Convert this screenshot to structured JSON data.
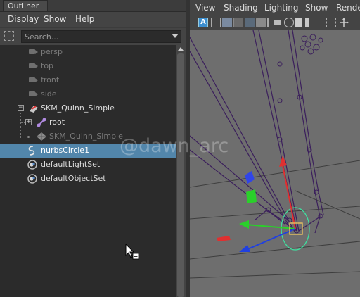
{
  "outliner": {
    "tab_label": "Outliner",
    "menus": [
      "Display",
      "Show",
      "Help"
    ],
    "search": {
      "placeholder": "Search..."
    },
    "items": [
      {
        "label": "persp",
        "icon": "camera-icon",
        "dim": true
      },
      {
        "label": "top",
        "icon": "camera-icon",
        "dim": true
      },
      {
        "label": "front",
        "icon": "camera-icon",
        "dim": true
      },
      {
        "label": "side",
        "icon": "camera-icon",
        "dim": true
      },
      {
        "label": "SKM_Quinn_Simple",
        "icon": "transform-group-icon",
        "dim": false
      },
      {
        "label": "root",
        "icon": "joint-icon",
        "dim": false
      },
      {
        "label": "SKM_Quinn_Simple",
        "icon": "mesh-icon",
        "dim": true
      },
      {
        "label": "nurbsCircle1",
        "icon": "nurbs-curve-icon",
        "selected": true
      },
      {
        "label": "defaultLightSet",
        "icon": "set-icon",
        "dim": false
      },
      {
        "label": "defaultObjectSet",
        "icon": "set-icon",
        "dim": false
      }
    ]
  },
  "viewport": {
    "menus": [
      "View",
      "Shading",
      "Lighting",
      "Show",
      "Rende"
    ],
    "toolbar_icons": [
      "select-camera-icon",
      "camera-attributes-icon",
      "bookmark-icon",
      "image-plane-icon",
      "grid-icon",
      "wireframe-icon",
      "smooth-shade-icon",
      "textured-icon",
      "lights-icon",
      "shadows-icon",
      "isolate-icon",
      "xray-icon",
      "resolution-gate-icon",
      "move-tool-icon"
    ]
  },
  "watermark": "@dawn_arc",
  "colors": {
    "selection": "#5286ab",
    "wireframe": "#4a2a6e",
    "manip_x": "#e03030",
    "manip_y": "#2ad02a",
    "manip_z": "#2040e0",
    "control_circle": "#3fe0a0"
  }
}
